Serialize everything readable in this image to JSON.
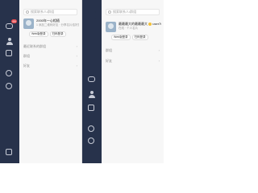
{
  "left": {
    "badge": "99",
    "search_placeholder": "搜索联系人/群组",
    "profile": {
      "name": "2000年一心相随",
      "status": "1 添加二维码好友 · 分享名片给好友"
    },
    "pills": [
      "Web版登录",
      "扫码登录"
    ],
    "sections": [
      "最近联系的群组",
      "群组",
      "好友"
    ]
  },
  "right": {
    "search_placeholder": "搜索联系人/群组",
    "profile": {
      "name": "最最最大的最最最大",
      "tag": "user760",
      "status": "在线 · 个人名片"
    },
    "pills": [
      "Web版登录",
      "扫码登录"
    ],
    "sections": [
      "群组",
      "好友"
    ]
  },
  "colors": {
    "rail": "#27324b",
    "badge": "#e5484d"
  }
}
